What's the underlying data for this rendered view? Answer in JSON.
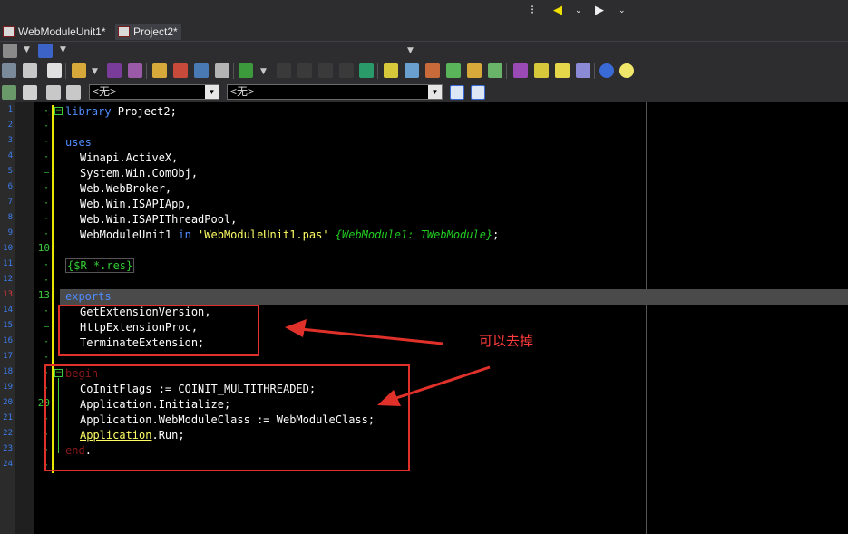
{
  "tabs": [
    {
      "label": "WebModuleUnit1*"
    },
    {
      "label": "Project2*"
    }
  ],
  "combos": {
    "left_value": "<无>",
    "right_value": "<无>"
  },
  "editor": {
    "line_numbers": [
      "1",
      "2",
      "3",
      "4",
      "5",
      "6",
      "7",
      "8",
      "9",
      "10",
      "11",
      "12",
      "13",
      "14",
      "15",
      "16",
      "17",
      "18",
      "19",
      "20",
      "21",
      "22",
      "23",
      "24"
    ],
    "markers": {
      "line10": "10",
      "line13": "13",
      "line20": "20"
    },
    "code": {
      "l1_kw": "library",
      "l1_rest": " Project2;",
      "l3_kw": "uses",
      "l4": "Winapi.ActiveX,",
      "l5": "System.Win.ComObj,",
      "l6": "Web.WebBroker,",
      "l7": "Web.Win.ISAPIApp,",
      "l8": "Web.Win.ISAPIThreadPool,",
      "l9_a": "WebModuleUnit1 ",
      "l9_kw": "in",
      "l9_str": " 'WebModuleUnit1.pas'",
      "l9_cmt": " {WebModule1: TWebModule}",
      "l9_end": ";",
      "l11": "{$R *.res}",
      "l13_kw": "exports",
      "l14": "GetExtensionVersion,",
      "l15": "HttpExtensionProc,",
      "l16": "TerminateExtension;",
      "l18_kw": "begin",
      "l19": "CoInitFlags := COINIT_MULTITHREADED;",
      "l20": "Application.Initialize;",
      "l21": "Application.WebModuleClass := WebModuleClass;",
      "l22_a": "Application",
      "l22_b": ".Run;",
      "l23_kw": "end",
      "l23_end": "."
    }
  },
  "annotation": {
    "note": "可以去掉",
    "color": "#e0302a"
  }
}
